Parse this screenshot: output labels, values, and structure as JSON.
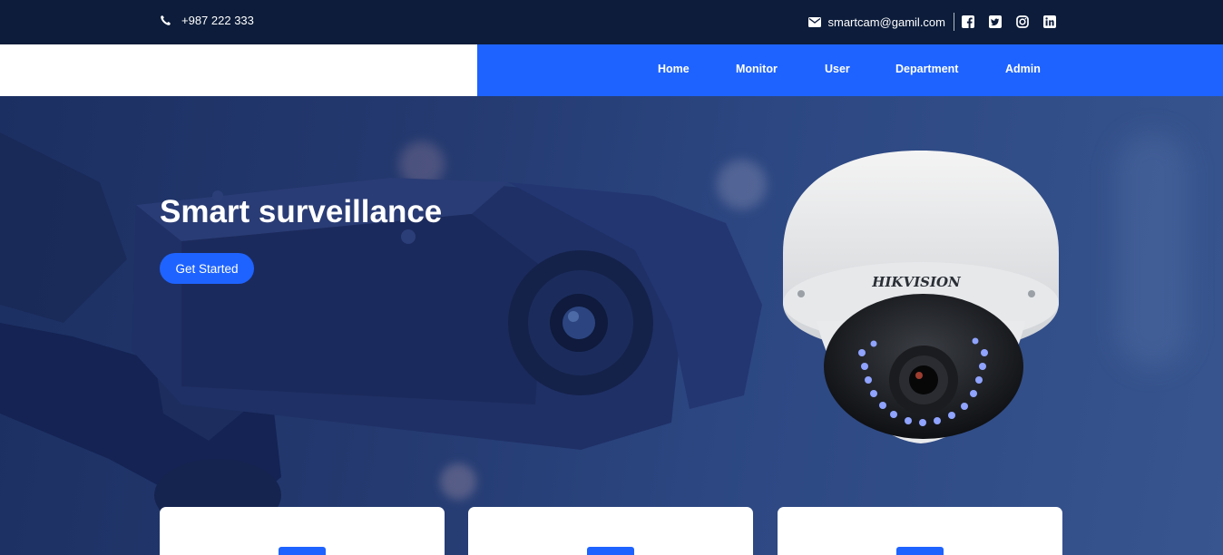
{
  "topbar": {
    "phone": "+987 222 333",
    "email": "smartcam@gamil.com",
    "social_icons": [
      "facebook-icon",
      "twitter-icon",
      "instagram-icon",
      "linkedin-icon"
    ]
  },
  "nav": {
    "items": [
      {
        "label": "Home"
      },
      {
        "label": "Monitor"
      },
      {
        "label": "User"
      },
      {
        "label": "Department"
      },
      {
        "label": "Admin"
      }
    ]
  },
  "hero": {
    "title": "Smart surveillance",
    "cta_label": "Get Started",
    "camera_brand": "HIKVISION"
  },
  "colors": {
    "topbar": "#0c1c3a",
    "accent": "#1e63ff",
    "hero_overlay": "#243a70",
    "card": "#ffffff"
  }
}
